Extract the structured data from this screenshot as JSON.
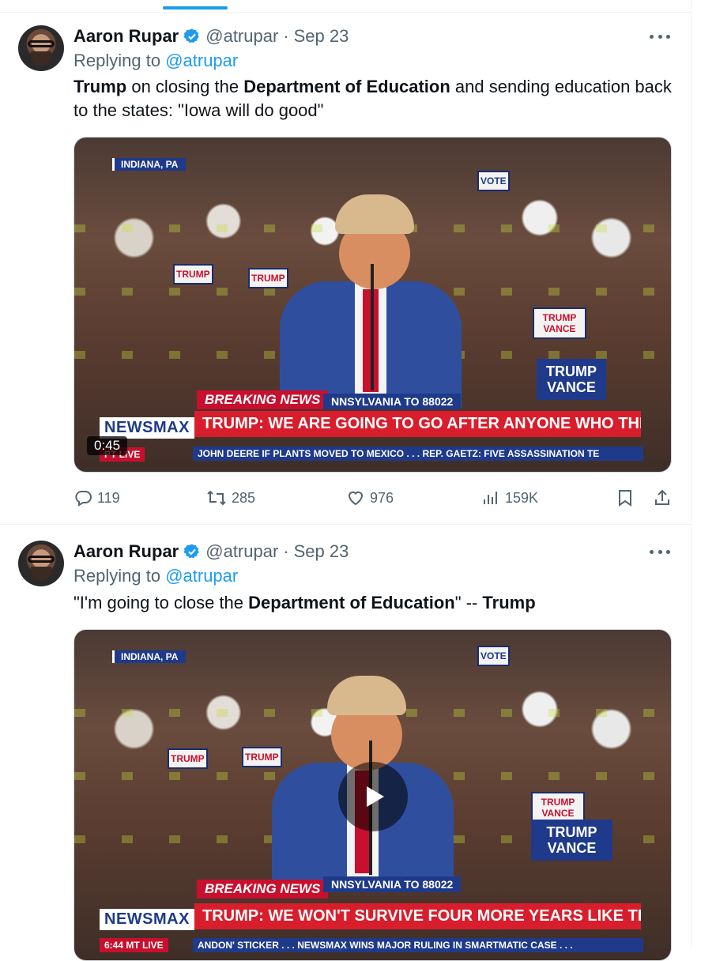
{
  "tweets": [
    {
      "author_name": "Aaron Rupar",
      "handle": "@atrupar",
      "separator": "·",
      "date": "Sep 23",
      "replying_prefix": "Replying to ",
      "replying_to": "@atrupar",
      "text_parts": [
        "Trump",
        " on closing the ",
        "Department of Education",
        " and sending education back to the states: \"Iowa will do good\""
      ],
      "video": {
        "location": "INDIANA, PA",
        "breaking": "BREAKING NEWS",
        "banner_top": "NNSYLVANIA  TO 88022",
        "network": "NEWSMAX",
        "headline": "TRUMP: WE ARE GOING TO GO AFTER ANYONE WHO THREATENS DEMOCRACY",
        "live_label": "PT   LIVE",
        "ticker": "JOHN DEERE IF PLANTS MOVED TO MEXICO . . .     REP. GAETZ: FIVE ASSASSINATION TE",
        "duration": "0:45",
        "signs": [
          "TRUMP",
          "TRUMP",
          "TRUMP VANCE",
          "TRUMP VANCE",
          "VOTE"
        ]
      },
      "stats": {
        "replies": "119",
        "reposts": "285",
        "likes": "976",
        "views": "159K"
      }
    },
    {
      "author_name": "Aaron Rupar",
      "handle": "@atrupar",
      "separator": "·",
      "date": "Sep 23",
      "replying_prefix": "Replying to ",
      "replying_to": "@atrupar",
      "text_parts": [
        "\"I'm going to close the ",
        "Department of Education",
        "\" -- ",
        "Trump"
      ],
      "video": {
        "location": "INDIANA, PA",
        "breaking": "BREAKING NEWS",
        "banner_top": "NNSYLVANIA  TO 88022",
        "network": "NEWSMAX",
        "headline": "TRUMP: WE WON'T SURVIVE FOUR MORE YEARS LIKE THIS",
        "live_label": "6:44 MT   LIVE",
        "ticker": "ANDON' STICKER . . .     NEWSMAX WINS MAJOR RULING IN SMARTMATIC CASE . . .",
        "signs": [
          "TRUMP",
          "TRUMP",
          "TRUMP VANCE",
          "TRUMP VANCE",
          "VOTE"
        ]
      }
    }
  ],
  "colors": {
    "accent": "#1d9bf0",
    "text": "#0f1419",
    "muted": "#536471",
    "newsmax_red": "#d81e2c",
    "newsmax_blue": "#1f3a8a"
  },
  "icons": {
    "verified": "verified-badge-icon",
    "more": "more-icon",
    "reply": "reply-icon",
    "repost": "repost-icon",
    "like": "heart-icon",
    "views": "views-icon",
    "bookmark": "bookmark-icon",
    "share": "share-icon",
    "play": "play-icon"
  }
}
